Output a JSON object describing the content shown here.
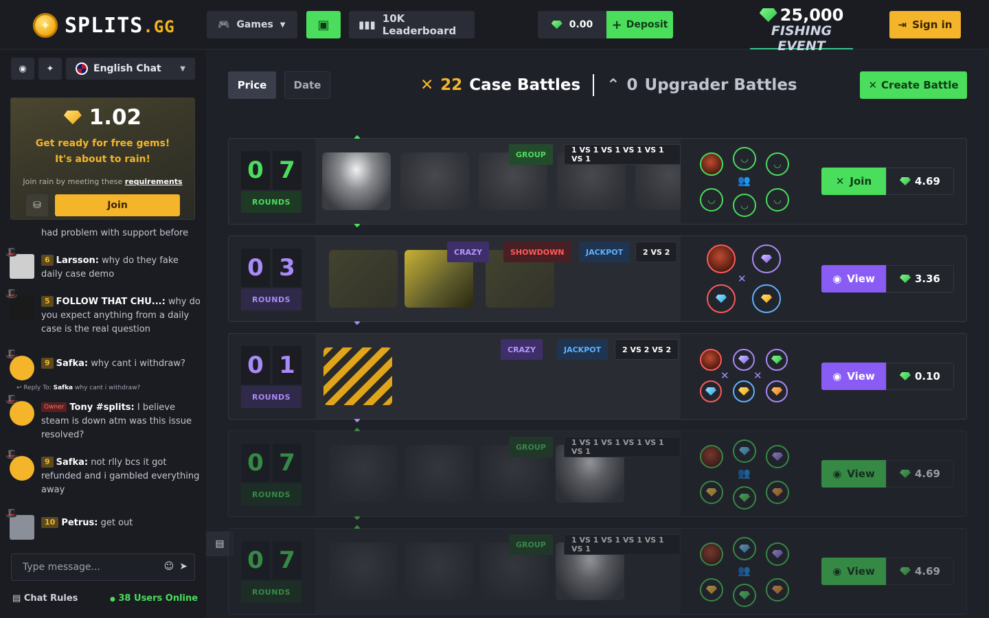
{
  "header": {
    "logo_text": "SPLITS",
    "logo_suffix": ".GG",
    "games_label": "Games",
    "leaderboard_label": "10K Leaderboard",
    "balance": "0.00",
    "deposit_label": "Deposit",
    "event_amount": "25,000",
    "event_name": "FISHING EVENT",
    "signin_label": "Sign in"
  },
  "sidebar": {
    "language": "English Chat",
    "rain": {
      "amount": "1.02",
      "line1": "Get ready for free gems!",
      "line2": "It's about to rain!",
      "sub_prefix": "Join rain by meeting these",
      "sub_link": "requirements",
      "join_label": "Join"
    },
    "messages": [
      {
        "text": "had problem with support before"
      },
      {
        "level": "6",
        "user": "Larsson:",
        "text": "why do they fake daily case demo"
      },
      {
        "level": "5",
        "user": "FOLLOW THAT CHU...:",
        "text": "why do you expect anything from a daily case is the real question"
      },
      {
        "level": "9",
        "user": "Safka:",
        "text": "why cant i withdraw?"
      },
      {
        "reply_prefix": "Reply To:",
        "reply_user": "Safka",
        "reply_text": "why cant i withdraw?"
      },
      {
        "badge": "Owner",
        "user": "Tony #splits:",
        "text": "I believe steam is down atm was this issue resolved?"
      },
      {
        "level": "9",
        "user": "Safka:",
        "text": "not rlly bcs it got refunded and i gambled everything away"
      },
      {
        "level": "10",
        "user": "Petrus:",
        "text": "get out"
      }
    ],
    "input_placeholder": "Type message...",
    "chat_rules": "Chat Rules",
    "online": "38 Users Online"
  },
  "main": {
    "sort_price": "Price",
    "sort_date": "Date",
    "case_count": "22",
    "case_label": "Case Battles",
    "upgrader_count": "0",
    "upgrader_label": "Upgrader Battles",
    "create_label": "Create Battle"
  },
  "battles": [
    {
      "d1": "0",
      "d2": "7",
      "rounds": "ROUNDS",
      "tags": [
        "GROUP",
        "1 VS 1 VS 1 VS 1 VS 1 VS 1"
      ],
      "action": "Join",
      "price": "4.69"
    },
    {
      "d1": "0",
      "d2": "3",
      "rounds": "ROUNDS",
      "tags": [
        "CRAZY",
        "SHOWDOWN",
        "JACKPOT",
        "2 VS 2"
      ],
      "action": "View",
      "price": "3.36"
    },
    {
      "d1": "0",
      "d2": "1",
      "rounds": "ROUNDS",
      "tags": [
        "CRAZY",
        "JACKPOT",
        "2 VS 2 VS 2"
      ],
      "action": "View",
      "price": "0.10"
    },
    {
      "d1": "0",
      "d2": "7",
      "rounds": "ROUNDS",
      "tags": [
        "GROUP",
        "1 VS 1 VS 1 VS 1 VS 1 VS 1"
      ],
      "action": "View",
      "price": "4.69"
    },
    {
      "d1": "0",
      "d2": "7",
      "rounds": "ROUNDS",
      "tags": [
        "GROUP",
        "1 VS 1 VS 1 VS 1 VS 1 VS 1"
      ],
      "action": "View",
      "price": "4.69"
    }
  ],
  "colors": {
    "accent_green": "#4ade5c",
    "accent_purple": "#8a5cf6",
    "accent_yellow": "#f4b52a",
    "background": "#1f2129"
  },
  "icons": [
    "gamepad-icon",
    "gift-icon",
    "leaderboard-icon",
    "gem-icon",
    "plus-icon",
    "signin-icon",
    "discord-icon",
    "twitter-icon",
    "flag-icon",
    "swords-icon",
    "upgrader-icon",
    "eye-icon",
    "group-icon",
    "send-icon",
    "emoji-icon",
    "chat-icon"
  ]
}
